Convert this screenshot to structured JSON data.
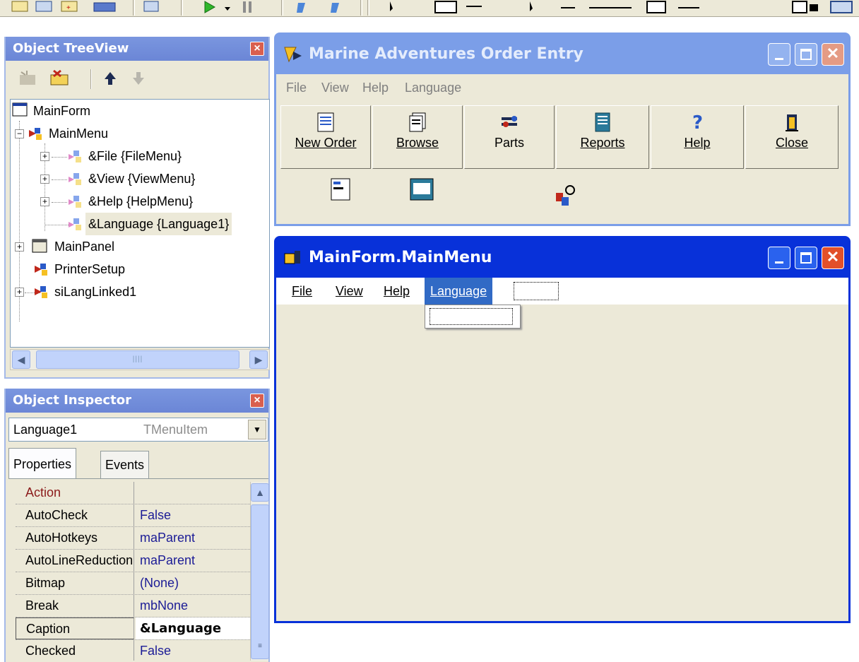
{
  "tree_view": {
    "title": "Object TreeView",
    "nodes": [
      {
        "label": "MainForm"
      },
      {
        "label": "MainMenu"
      },
      {
        "label": "&File {FileMenu}"
      },
      {
        "label": "&View {ViewMenu}"
      },
      {
        "label": "&Help {HelpMenu}"
      },
      {
        "label": "&Language {Language1}"
      },
      {
        "label": "MainPanel"
      },
      {
        "label": "PrinterSetup"
      },
      {
        "label": "siLangLinked1"
      }
    ]
  },
  "inspector": {
    "title": "Object Inspector",
    "object_name": "Language1",
    "object_type": "TMenuItem",
    "tabs": [
      "Properties",
      "Events"
    ],
    "properties": [
      {
        "name": "Action",
        "value": ""
      },
      {
        "name": "AutoCheck",
        "value": "False"
      },
      {
        "name": "AutoHotkeys",
        "value": "maParent"
      },
      {
        "name": "AutoLineReduction",
        "value": "maParent"
      },
      {
        "name": "Bitmap",
        "value": "(None)"
      },
      {
        "name": "Break",
        "value": "mbNone"
      },
      {
        "name": "Caption",
        "value": "&Language"
      },
      {
        "name": "Checked",
        "value": "False"
      }
    ],
    "selected_property": "Caption"
  },
  "app_window": {
    "title": "Marine Adventures Order Entry",
    "menu": [
      "File",
      "View",
      "Help",
      "Language"
    ],
    "buttons": [
      {
        "label": "New Order",
        "icon": "new-order-icon"
      },
      {
        "label": "Browse",
        "icon": "browse-icon"
      },
      {
        "label": "Parts",
        "icon": "parts-icon"
      },
      {
        "label": "Reports",
        "icon": "reports-icon"
      },
      {
        "label": "Help",
        "icon": "help-question-icon"
      },
      {
        "label": "Close",
        "icon": "close-door-icon"
      }
    ]
  },
  "menu_designer": {
    "title": "MainForm.MainMenu",
    "menu": [
      "File",
      "View",
      "Help",
      "Language"
    ],
    "selected": "Language"
  },
  "colors": {
    "title_active": "#0831d9",
    "title_inactive": "#7b9ee8",
    "face": "#ece9d8",
    "menu_highlight": "#316ac5",
    "property_value": "#1c1c96",
    "event_property": "#8b1a1a"
  }
}
